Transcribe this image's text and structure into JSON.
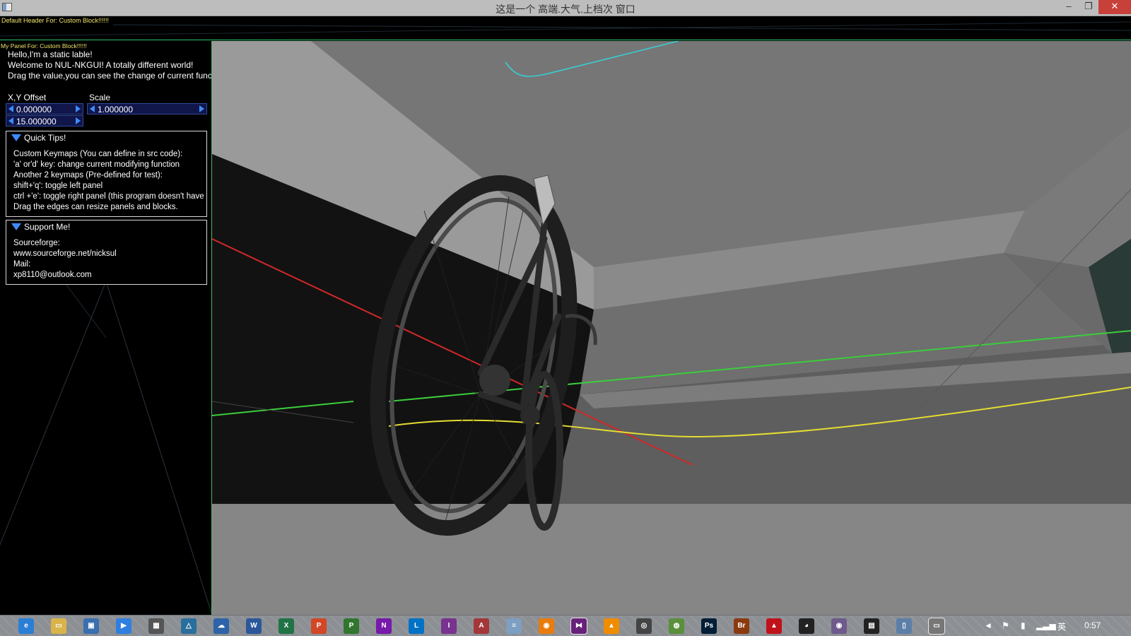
{
  "window": {
    "title": "这是一个 高端.大气.上档次 窗口",
    "min_label": "–",
    "max_label": "❐",
    "close_label": "✕"
  },
  "header": {
    "text": "Default Header For: Custom Block!!!!!!"
  },
  "panel": {
    "title": "My Panel For: Custom Block!!!!!!",
    "lines": [
      "Hello,I'm a static lable!",
      "Welcome to NUL-NKGUI! A totally different world!",
      "Drag the value,you can see the change of current functio"
    ],
    "xy_label": "X,Y Offset",
    "scale_label": "Scale",
    "x_value": "0.000000",
    "y_value": "15.000000",
    "scale_value": "1.000000",
    "tips": {
      "title": "Quick Tips!",
      "lines": [
        "Custom Keymaps (You can define in src code):",
        "  'a' or'd' key: change current modifying function",
        "Another 2 keymaps (Pre-defined for test):",
        "  shift+'q': toggle left panel",
        "  ctrl +'e': toggle right panel (this program doesn't have",
        "Drag the edges can resize panels and blocks."
      ]
    },
    "support": {
      "title": "Support Me!",
      "lines": [
        "Sourceforge:",
        "  www.sourceforge.net/nicksul",
        "Mail:",
        "  xp8110@outlook.com"
      ]
    }
  },
  "taskbar": {
    "icons": [
      {
        "name": "internet-explorer-icon",
        "glyph": "e",
        "color": "#2a7fd4"
      },
      {
        "name": "file-explorer-icon",
        "glyph": "▭",
        "color": "#d9b44a"
      },
      {
        "name": "remote-desktop-icon",
        "glyph": "▣",
        "color": "#3a6fb0"
      },
      {
        "name": "media-player-icon",
        "glyph": "▶",
        "color": "#2f7fe0"
      },
      {
        "name": "calculator-icon",
        "glyph": "▦",
        "color": "#555"
      },
      {
        "name": "app-triangle-icon",
        "glyph": "△",
        "color": "#2a6e9e"
      },
      {
        "name": "onedrive-icon",
        "glyph": "☁",
        "color": "#2d63a8"
      },
      {
        "name": "word-icon",
        "glyph": "W",
        "color": "#2b579a"
      },
      {
        "name": "excel-icon",
        "glyph": "X",
        "color": "#217346"
      },
      {
        "name": "powerpoint-icon",
        "glyph": "P",
        "color": "#d24726"
      },
      {
        "name": "project-icon",
        "glyph": "P",
        "color": "#31752f"
      },
      {
        "name": "onenote-icon",
        "glyph": "N",
        "color": "#7719aa"
      },
      {
        "name": "lync-icon",
        "glyph": "L",
        "color": "#0072c6"
      },
      {
        "name": "infopath-icon",
        "glyph": "I",
        "color": "#77338f"
      },
      {
        "name": "access-icon",
        "glyph": "A",
        "color": "#a4373a"
      },
      {
        "name": "notepad-icon",
        "glyph": "≡",
        "color": "#7d9fc1"
      },
      {
        "name": "blender-icon",
        "glyph": "◉",
        "color": "#e87d0d"
      },
      {
        "name": "visual-studio-icon",
        "glyph": "⧓",
        "color": "#68217a"
      },
      {
        "name": "vlc-icon",
        "glyph": "▲",
        "color": "#f08c00"
      },
      {
        "name": "game-controller-icon",
        "glyph": "◎",
        "color": "#444"
      },
      {
        "name": "chrome-icon",
        "glyph": "◍",
        "color": "#5a8f3c"
      },
      {
        "name": "photoshop-icon",
        "glyph": "Ps",
        "color": "#001e36"
      },
      {
        "name": "bridge-icon",
        "glyph": "Br",
        "color": "#8b3a0f"
      },
      {
        "name": "acrobat-icon",
        "glyph": "▲",
        "color": "#c1121b"
      },
      {
        "name": "qq-icon",
        "glyph": "◕",
        "color": "#222"
      },
      {
        "name": "app-circle-icon",
        "glyph": "◉",
        "color": "#6e5a8c"
      },
      {
        "name": "terminal-icon",
        "glyph": "▤",
        "color": "#222"
      },
      {
        "name": "document-icon",
        "glyph": "▯",
        "color": "#5c7fa8"
      },
      {
        "name": "active-window-icon",
        "glyph": "▭",
        "color": "#777"
      }
    ],
    "tray_lang": "英",
    "clock": "0:57"
  }
}
